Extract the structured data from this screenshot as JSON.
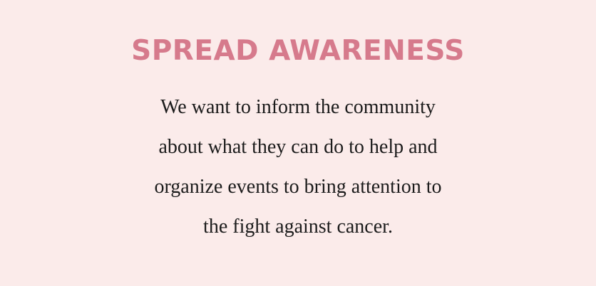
{
  "section": {
    "title": "SPREAD AWARENESS",
    "body_lines": [
      "We want to inform the community",
      "about what they can do to help and",
      "organize events to bring attention to",
      "the fight against cancer."
    ]
  },
  "colors": {
    "background": "#fbebea",
    "title": "#d67a8c",
    "body": "#1b1b1b"
  }
}
